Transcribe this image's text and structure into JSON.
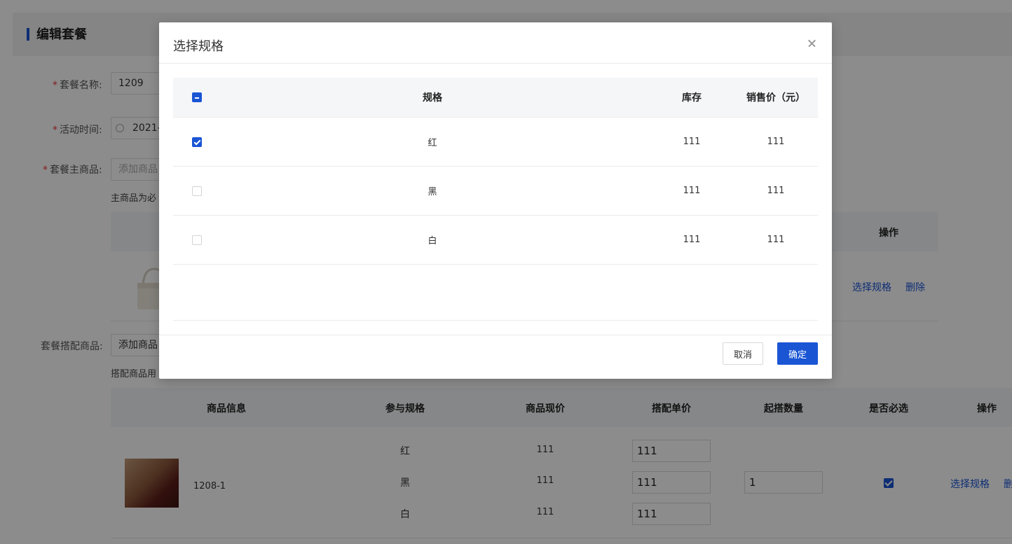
{
  "page": {
    "title": "编辑套餐",
    "package_name_label": "套餐名称:",
    "package_name_value": "1209",
    "activity_time_label": "活动时间:",
    "activity_time_value": "2021-",
    "main_product_label": "套餐主商品:",
    "main_product_placeholder": "添加商品",
    "main_product_hint": "主商品为必",
    "main_table_action_header": "操作",
    "main_row_links": {
      "select_spec": "选择规格",
      "delete": "删除"
    },
    "combo_product_label": "套餐搭配商品:",
    "combo_add_button": "添加商品",
    "combo_hint": "搭配商品用",
    "combo_table": {
      "headers": [
        "商品信息",
        "参与规格",
        "商品现价",
        "搭配单价",
        "起搭数量",
        "是否必选",
        "操作"
      ],
      "row": {
        "product_name": "1208-1",
        "specs": [
          {
            "spec": "红",
            "current_price": "111",
            "combo_price": "111"
          },
          {
            "spec": "黑",
            "current_price": "111",
            "combo_price": "111"
          },
          {
            "spec": "白",
            "current_price": "111",
            "combo_price": "111"
          }
        ],
        "min_quantity": "1",
        "required_checked": true,
        "select_spec_link": "选择规格",
        "delete_link": "删"
      }
    }
  },
  "modal": {
    "title": "选择规格",
    "table": {
      "headers": {
        "spec": "规格",
        "stock": "库存",
        "price": "销售价（元）"
      },
      "header_check_state": "indeterminate",
      "rows": [
        {
          "spec": "红",
          "stock": "111",
          "price": "111",
          "checked": true
        },
        {
          "spec": "黑",
          "stock": "111",
          "price": "111",
          "checked": false
        },
        {
          "spec": "白",
          "stock": "111",
          "price": "111",
          "checked": false
        }
      ]
    },
    "buttons": {
      "cancel": "取消",
      "confirm": "确定"
    }
  },
  "colors": {
    "primary": "#1a55d4",
    "required": "#e33333"
  }
}
